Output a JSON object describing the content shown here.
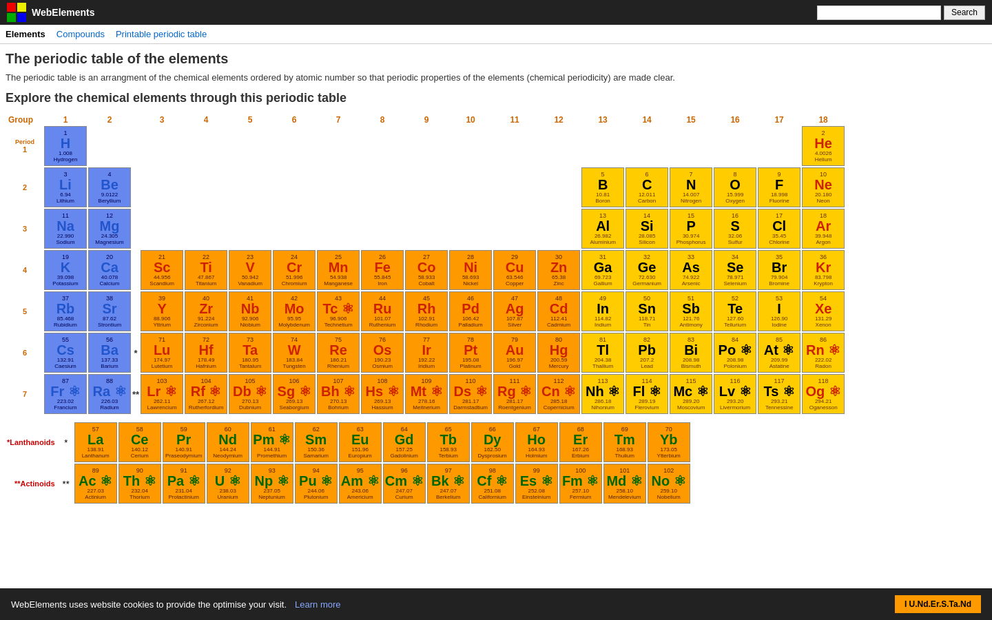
{
  "header": {
    "title": "WebElements",
    "search_placeholder": "",
    "search_label": "Search"
  },
  "nav": {
    "elements": "Elements",
    "compounds": "Compounds",
    "printable": "Printable periodic table"
  },
  "page": {
    "title": "The periodic table of the elements",
    "description": "The periodic table is an arrangment of the chemical elements ordered by atomic number so that periodic properties of the elements (chemical periodicity) are made clear.",
    "explore_title": "Explore the chemical elements through this periodic table"
  },
  "table": {
    "group_label": "Group",
    "period_label": "Period"
  },
  "cookie": {
    "message": "WebElements uses website cookies to provide the optimise your visit.",
    "learn_more": "Learn more",
    "accept": "I U.Nd.Er.S.Ta.Nd"
  }
}
